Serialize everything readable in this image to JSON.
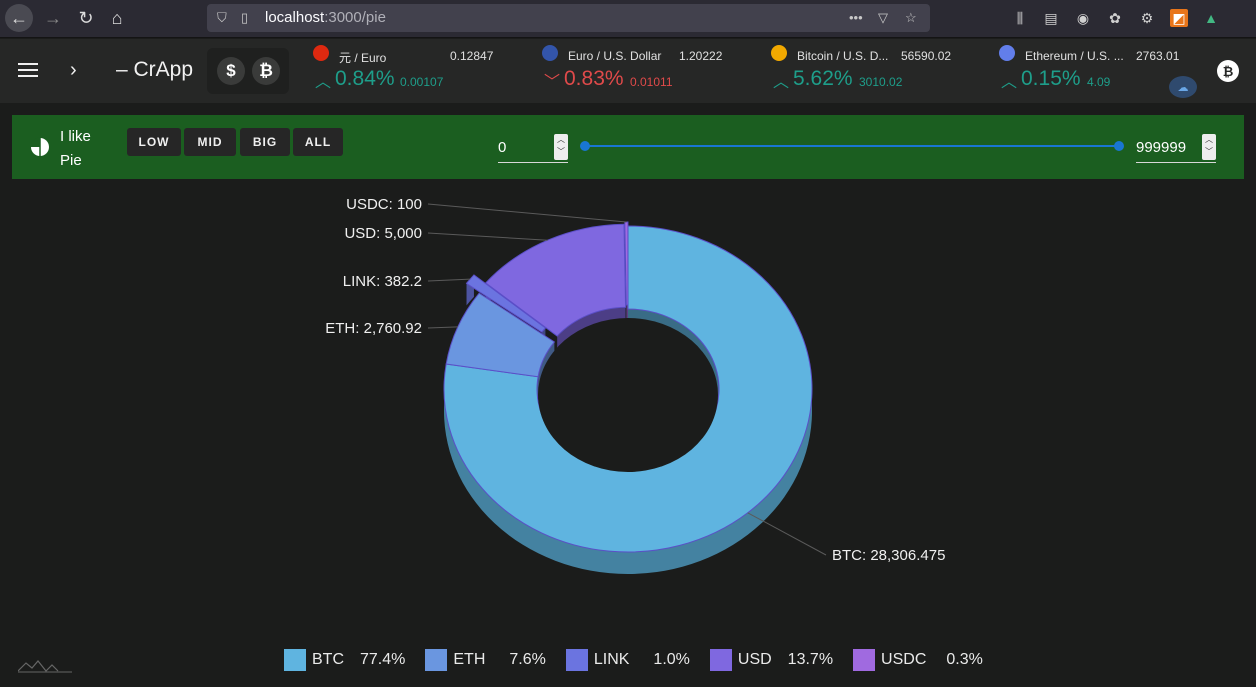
{
  "browser": {
    "url_host": "localhost",
    "url_path": ":3000/pie"
  },
  "app": {
    "brand": "CrApp",
    "coin_usd": "$",
    "coin_btc": "₿"
  },
  "tickers": [
    {
      "pair": "元 / Euro",
      "price": "0.12847",
      "direction": "up",
      "pct": "0.84%",
      "delta": "0.00107"
    },
    {
      "pair": "Euro / U.S. Dollar",
      "price": "1.20222",
      "direction": "down",
      "pct": "0.83%",
      "delta": "0.01011"
    },
    {
      "pair": "Bitcoin / U.S. D...",
      "price": "56590.02",
      "direction": "up",
      "pct": "5.62%",
      "delta": "3010.02"
    },
    {
      "pair": "Ethereum / U.S. ...",
      "price": "2763.01",
      "direction": "up",
      "pct": "0.15%",
      "delta": "4.09"
    }
  ],
  "filter": {
    "title_line1": "I like",
    "title_line2": "Pie",
    "buttons": [
      "LOW",
      "MID",
      "BIG",
      "ALL"
    ],
    "min_value": "0",
    "max_value": "999999"
  },
  "colors": {
    "BTC": "#5fb4e0",
    "ETH": "#6a96e0",
    "LINK": "#6b74e0",
    "USD": "#7f68e0",
    "USDC": "#a06ae0"
  },
  "chart_data": {
    "type": "pie",
    "categories": [
      "BTC",
      "ETH",
      "LINK",
      "USD",
      "USDC"
    ],
    "values": [
      28306.475,
      2760.92,
      382.2,
      5000,
      100
    ],
    "value_labels": [
      "BTC: 28,306.475",
      "ETH: 2,760.92",
      "LINK: 382.2",
      "USD: 5,000",
      "USDC: 100"
    ],
    "percentages": [
      "77.4%",
      "7.6%",
      "1.0%",
      "13.7%",
      "0.3%"
    ],
    "legend_position": "bottom"
  }
}
